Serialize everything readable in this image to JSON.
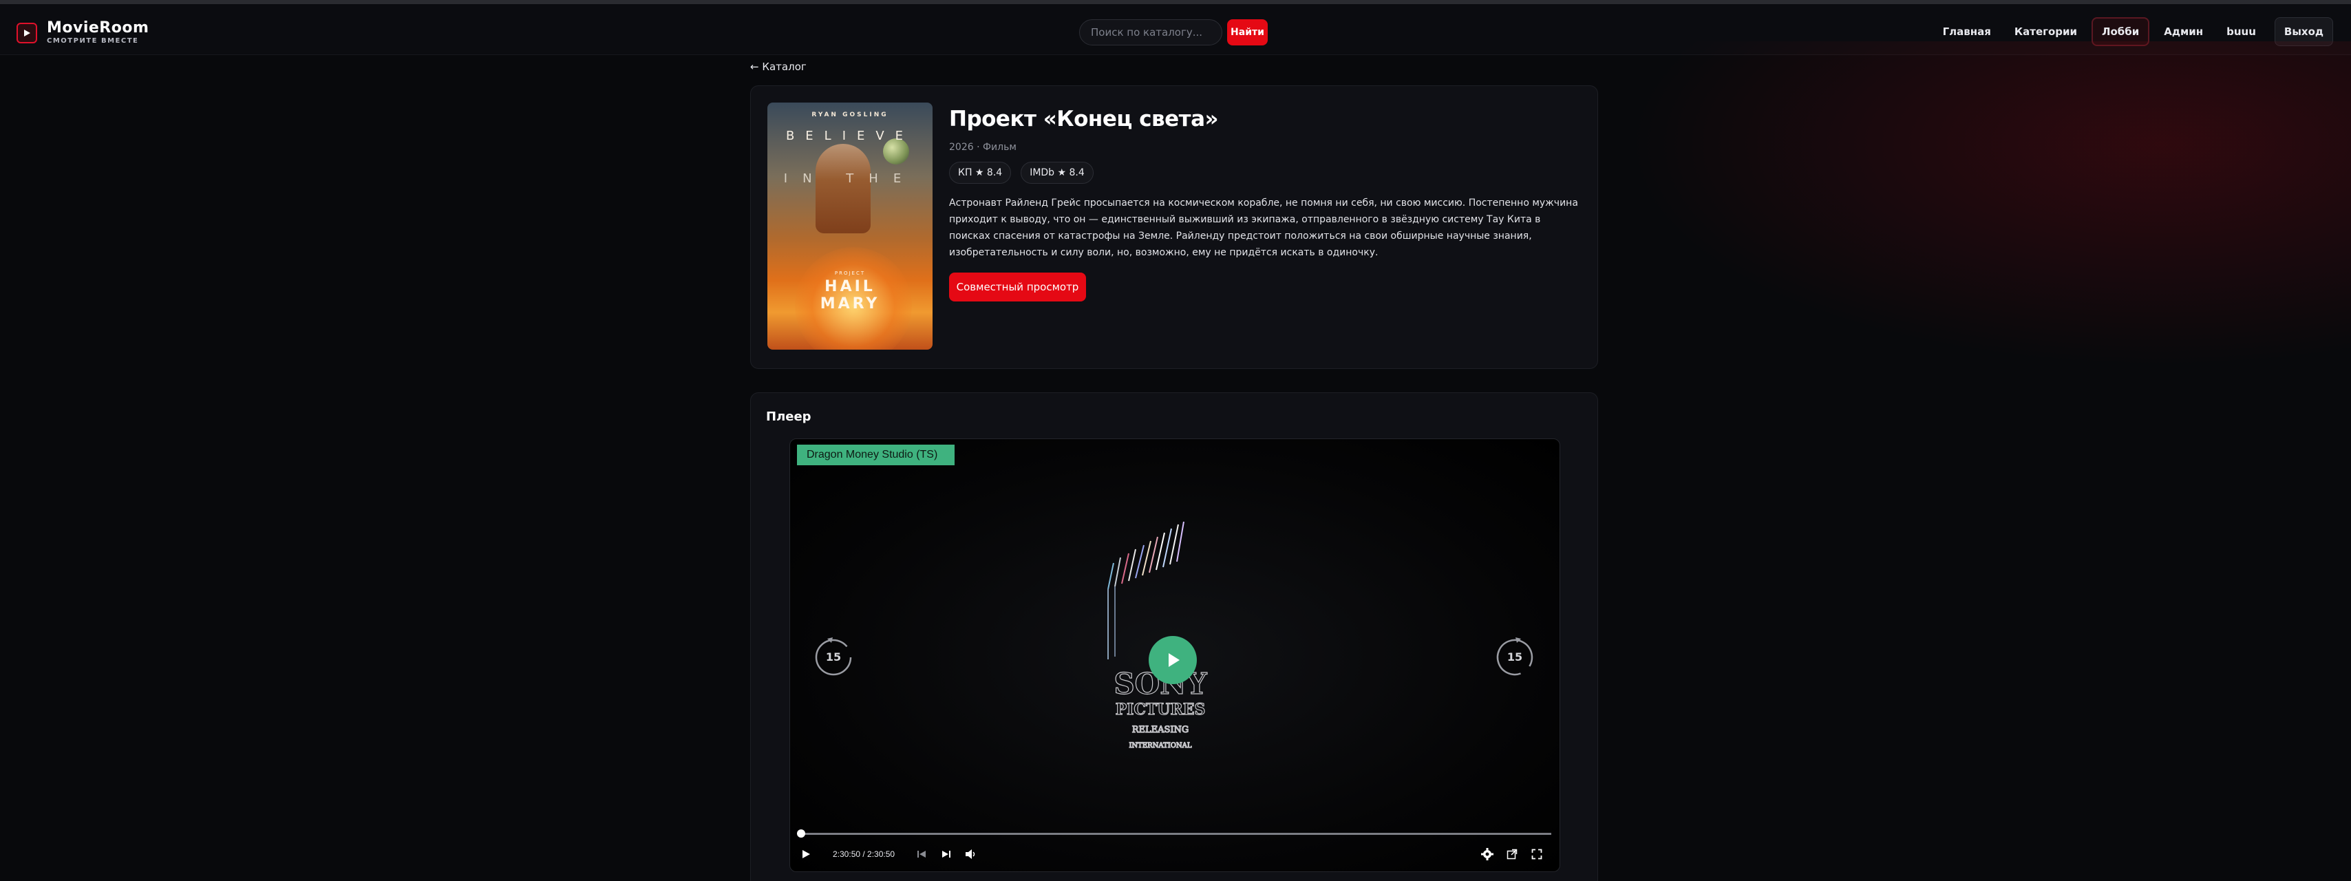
{
  "header": {
    "brand": "MovieRoom",
    "tagline": "СМОТРИТЕ ВМЕСТЕ",
    "search_placeholder": "Поиск по каталогу...",
    "search_button": "Найти",
    "nav": [
      "Главная",
      "Категории",
      "Лобби",
      "Админ",
      "buuu",
      "Выход"
    ],
    "active_nav": "Лобби"
  },
  "breadcrumb": "← Каталог",
  "movie": {
    "title": "Проект «Конец света»",
    "meta": "2026 · Фильм",
    "rating_kp": "КП ★ 8.4",
    "rating_imdb": "IMDb ★ 8.4",
    "description": "Астронавт Райленд Грейс просыпается на космическом корабле, не помня ни себя, ни свою миссию. Постепенно мужчина приходит к выводу, что он — единственный выживший из экипажа, отправленного в звёздную систему Тау Кита в поисках спасения от катастрофы на Земле. Райленду предстоит положиться на свои обширные научные знания, изобретательность и силу воли, но, возможно, ему не придётся искать в одиночку.",
    "watch_button": "Совместный просмотр",
    "poster": {
      "actor": "RYAN GOSLING",
      "line1": "BELIEVE",
      "line2": "IN THE",
      "project_label": "PROJECT",
      "title_line1": "HAIL",
      "title_line2": "MARY"
    }
  },
  "player": {
    "section_title": "Плеер",
    "source": "Dragon Money Studio (TS)",
    "time": "2:30:50  /  2:30:50",
    "skip_back": "15",
    "skip_forward": "15",
    "progress": 0
  },
  "colors": {
    "accent": "#e50914",
    "player_accent": "#3fb27f",
    "background": "#08090c"
  }
}
